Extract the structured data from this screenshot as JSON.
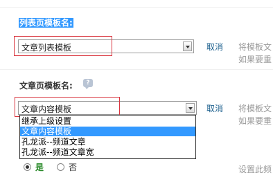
{
  "list_template": {
    "label": "列表页模板名:",
    "select_value": "文章列表模板",
    "cancel_link": "取消",
    "hint_line1": "将模板文",
    "hint_line2": "如果要重"
  },
  "article_template": {
    "label": "文章页模板名:",
    "help_icon": "?",
    "select_value": "文章内容模板",
    "options": [
      {
        "label": "继承上级设置",
        "selected": false
      },
      {
        "label": "文章内容模板",
        "selected": true
      },
      {
        "label": "孔龙派--频道文章",
        "selected": false
      },
      {
        "label": "孔龙派--频道文章宽",
        "selected": false
      }
    ],
    "cancel_link": "取消",
    "hint_line1": "将模板文",
    "hint_line2": "如果要重"
  },
  "radio_group": {
    "yes_label": "是",
    "no_label": "否",
    "selected": "yes",
    "hint": "设置此频"
  },
  "colors": {
    "selection_blue": "#3399ff",
    "highlight_red": "#d9343e",
    "link_blue": "#1a5e8c"
  }
}
